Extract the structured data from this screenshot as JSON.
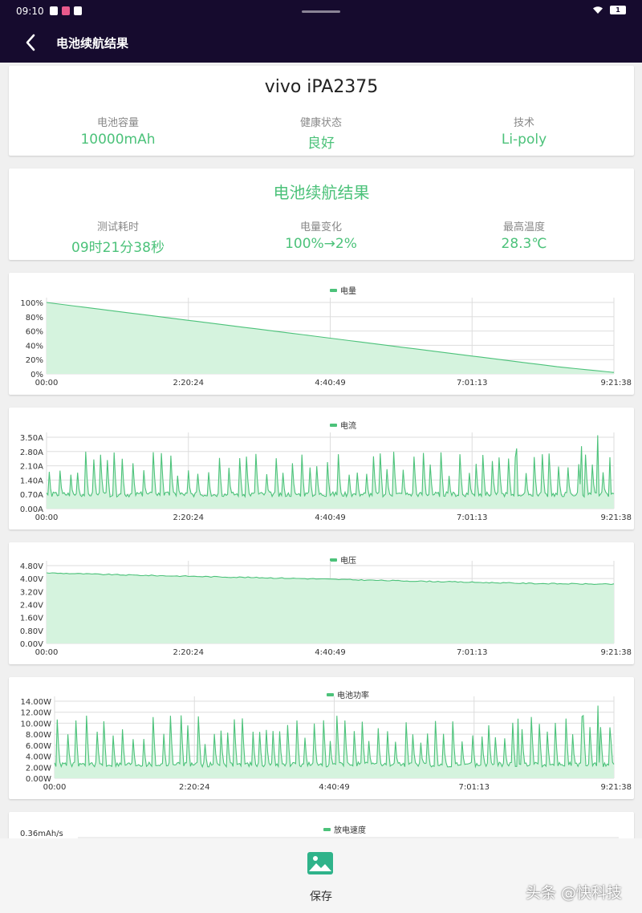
{
  "status": {
    "time": "09:10",
    "battery": "1"
  },
  "header": {
    "title": "电池续航结果"
  },
  "device": {
    "name": "vivo iPA2375",
    "stats": [
      {
        "label": "电池容量",
        "value": "10000mAh"
      },
      {
        "label": "健康状态",
        "value": "良好"
      },
      {
        "label": "技术",
        "value": "Li-poly"
      }
    ]
  },
  "result": {
    "title": "电池续航结果",
    "stats": [
      {
        "label": "测试耗时",
        "value": "09时21分38秒"
      },
      {
        "label": "电量变化",
        "value": "100%→2%"
      },
      {
        "label": "最高温度",
        "value": "28.3℃"
      }
    ]
  },
  "chart_data": [
    {
      "type": "area",
      "series_name": "电量",
      "x_ticks": [
        "00:00",
        "2:20:24",
        "4:40:49",
        "7:01:13",
        "9:21:38"
      ],
      "y_ticks": [
        "0%",
        "20%",
        "40%",
        "60%",
        "80%",
        "100%"
      ],
      "ylim": [
        0,
        100
      ],
      "values": [
        100,
        90,
        80,
        70,
        60,
        50,
        40,
        30,
        20,
        10,
        2
      ]
    },
    {
      "type": "area",
      "series_name": "电流",
      "x_ticks": [
        "00:00",
        "2:20:24",
        "4:40:49",
        "7:01:13",
        "9:21:38"
      ],
      "y_ticks": [
        "0.00A",
        "0.70A",
        "1.40A",
        "2.10A",
        "2.80A",
        "3.50A"
      ],
      "ylim": [
        0,
        3.5
      ],
      "base": 0.7,
      "peak_min": 1.6,
      "peak_max": 2.8,
      "max": 3.6
    },
    {
      "type": "area",
      "series_name": "电压",
      "x_ticks": [
        "00:00",
        "2:20:24",
        "4:40:49",
        "7:01:13",
        "9:21:38"
      ],
      "y_ticks": [
        "0.00V",
        "0.80V",
        "1.60V",
        "2.40V",
        "3.20V",
        "4.00V",
        "4.80V"
      ],
      "ylim": [
        0,
        4.8
      ],
      "values": [
        4.35,
        4.22,
        4.12,
        4.02,
        3.9,
        3.8,
        3.7,
        3.65
      ]
    },
    {
      "type": "area",
      "series_name": "电池功率",
      "x_ticks": [
        "00:00",
        "2:20:24",
        "4:40:49",
        "7:01:13",
        "9:21:38"
      ],
      "y_ticks": [
        "0.00W",
        "2.00W",
        "4.00W",
        "6.00W",
        "8.00W",
        "10.00W",
        "12.00W",
        "14.00W"
      ],
      "ylim": [
        0,
        14
      ],
      "base": 2.5,
      "peak_min": 6,
      "peak_max": 11.5,
      "max": 13.2
    },
    {
      "type": "area",
      "series_name": "放电速度",
      "y_ticks": [
        "0.36mAh/s"
      ]
    }
  ],
  "bottom": {
    "save_label": "保存"
  },
  "watermark": "头条 @快科技",
  "colors": {
    "accent": "#4cc27a",
    "header_bg": "#160b2e",
    "fill": "#d5f3de"
  }
}
